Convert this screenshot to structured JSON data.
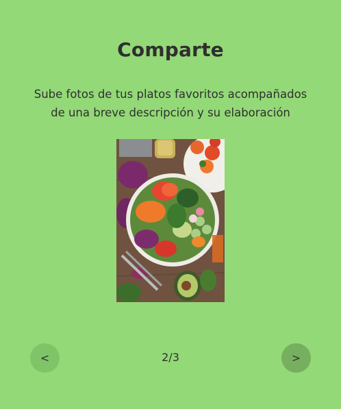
{
  "slide": {
    "title": "Comparte",
    "description": "Sube fotos de tus platos favoritos acompañados de una breve descripción y su elaboración",
    "image_icon": "salad-bowl-photo"
  },
  "carousel": {
    "prev_label": "<",
    "next_label": ">",
    "counter": "2/3",
    "current": 2,
    "total": 3
  },
  "colors": {
    "background": "#93d977",
    "button_prev": "#80c468",
    "button_next": "#76b05f",
    "text": "#2f2f2f"
  }
}
